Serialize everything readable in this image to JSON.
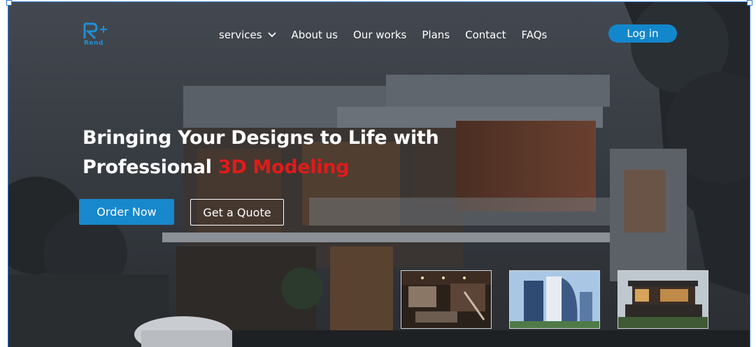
{
  "header": {
    "logo_icon": "rend-plus-logo",
    "logo_text": "Rend",
    "menu": [
      {
        "label": "services",
        "has_dropdown": true
      },
      {
        "label": "About us"
      },
      {
        "label": "Our works"
      },
      {
        "label": "Plans"
      },
      {
        "label": "Contact"
      },
      {
        "label": "FAQs"
      }
    ],
    "login_label": "Log in"
  },
  "hero": {
    "line1": "Bringing Your Designs to Life with",
    "line2_prefix": "Professional ",
    "line2_accent": "3D Modeling"
  },
  "actions": {
    "primary_label": "Order Now",
    "secondary_label": "Get a Quote"
  },
  "gallery": [
    {
      "icon": "interior-living-room-image"
    },
    {
      "icon": "modern-tower-image"
    },
    {
      "icon": "villa-exterior-image"
    }
  ],
  "colors": {
    "brand": "#1788cc",
    "accent": "#e01b1b",
    "text": "#ffffff"
  }
}
